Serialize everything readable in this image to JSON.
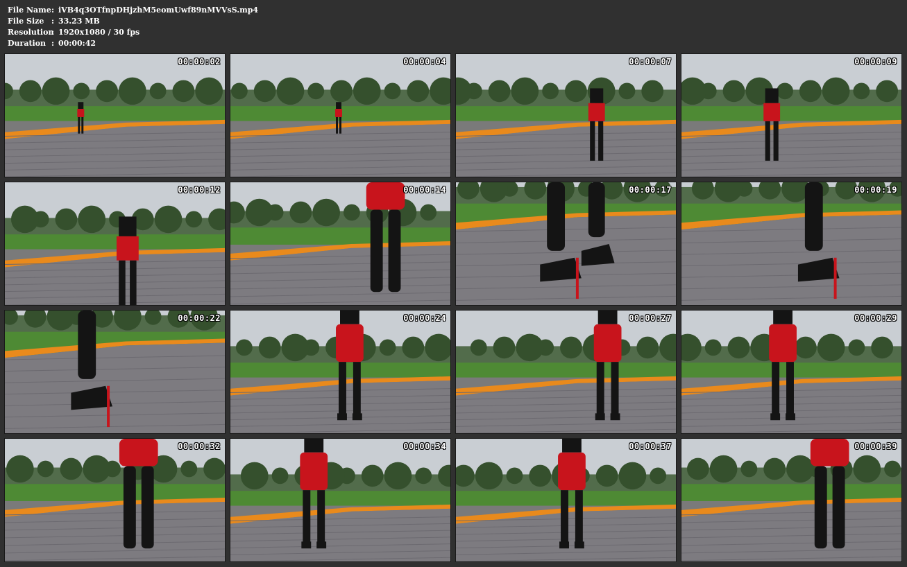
{
  "meta": {
    "file_name_label": "File Name",
    "file_name": "iVB4q3OTfnpDHjzhM5eomUwf89nMVVsS.mp4",
    "file_size_label": "File Size",
    "file_size": "33.23 MB",
    "resolution_label": "Resolution",
    "resolution": "1920x1080 / 30 fps",
    "duration_label": "Duration",
    "duration": "00:00:42",
    "separator": ":"
  },
  "thumbnails": [
    {
      "time": "00:00:02",
      "scene": "far"
    },
    {
      "time": "00:00:04",
      "scene": "far"
    },
    {
      "time": "00:00:07",
      "scene": "mid"
    },
    {
      "time": "00:00:09",
      "scene": "mid"
    },
    {
      "time": "00:00:12",
      "scene": "near"
    },
    {
      "time": "00:00:14",
      "scene": "legs"
    },
    {
      "time": "00:00:17",
      "scene": "shoes"
    },
    {
      "time": "00:00:19",
      "scene": "shoe"
    },
    {
      "time": "00:00:22",
      "scene": "shoe"
    },
    {
      "time": "00:00:24",
      "scene": "back"
    },
    {
      "time": "00:00:27",
      "scene": "back"
    },
    {
      "time": "00:00:29",
      "scene": "back"
    },
    {
      "time": "00:00:32",
      "scene": "legs"
    },
    {
      "time": "00:00:34",
      "scene": "back"
    },
    {
      "time": "00:00:37",
      "scene": "back"
    },
    {
      "time": "00:00:39",
      "scene": "legs"
    }
  ],
  "colors": {
    "sky": "#c9ced3",
    "grass": "#4e8a34",
    "flowers": "#e98a1c",
    "pavement": "#7d7b80",
    "skirt": "#c8141c",
    "latex": "#141414"
  }
}
